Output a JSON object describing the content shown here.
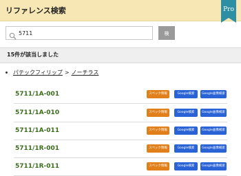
{
  "header": {
    "title": "リファレンス検索",
    "badge": "Pro"
  },
  "search": {
    "value": "5711",
    "button_label": "検索"
  },
  "results": {
    "summary": "15件が該当しました"
  },
  "breadcrumb": {
    "brand": "パテックフィリップ",
    "separator": ">",
    "model": "ノーチラス"
  },
  "items": [
    {
      "ref": "5711/1A-001",
      "spec_label": "スペック情報",
      "google_label": "Google検索",
      "google_images_label": "Google画像検索"
    },
    {
      "ref": "5711/1A-010",
      "spec_label": "スペック情報",
      "google_label": "Google検索",
      "google_images_label": "Google画像検索"
    },
    {
      "ref": "5711/1A-011",
      "spec_label": "スペック情報",
      "google_label": "Google検索",
      "google_images_label": "Google画像検索"
    },
    {
      "ref": "5711/1R-001",
      "spec_label": "スペック情報",
      "google_label": "Google検索",
      "google_images_label": "Google画像検索"
    },
    {
      "ref": "5711/1R-011",
      "spec_label": "スペック情報",
      "google_label": "Google検索",
      "google_images_label": "Google画像検索"
    }
  ],
  "colors": {
    "header_bg": "#f7e7b4",
    "badge": "#2e8ea3",
    "ref_text": "#3a6e1a",
    "spec_button": "#e1801a",
    "google_button": "#2a63d6"
  }
}
